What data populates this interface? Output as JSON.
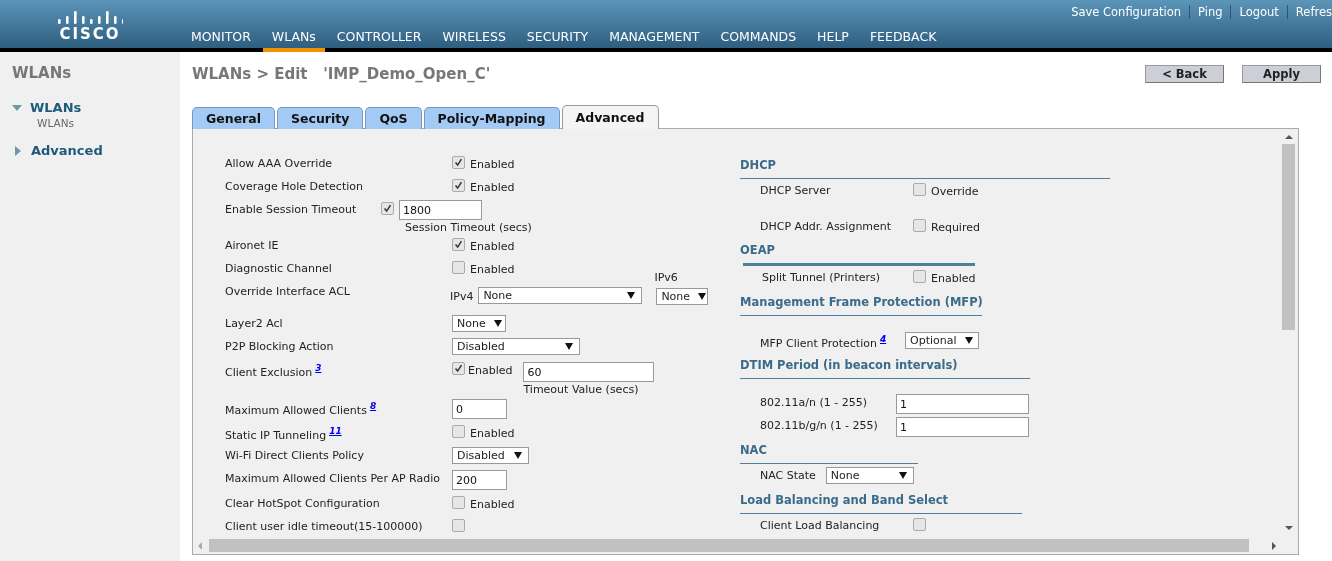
{
  "header": {
    "logo": "CISCO",
    "links": [
      {
        "label": "Save Configuration"
      },
      {
        "label": "Ping"
      },
      {
        "label": "Logout"
      },
      {
        "label": "Refres"
      }
    ],
    "nav": [
      {
        "label": "MONITOR",
        "selected": false
      },
      {
        "label": "WLANs",
        "selected": true
      },
      {
        "label": "CONTROLLER",
        "selected": false
      },
      {
        "label": "WIRELESS",
        "selected": false
      },
      {
        "label": "SECURITY",
        "selected": false
      },
      {
        "label": "MANAGEMENT",
        "selected": false
      },
      {
        "label": "COMMANDS",
        "selected": false
      },
      {
        "label": "HELP",
        "selected": false
      },
      {
        "label": "FEEDBACK",
        "selected": false
      }
    ]
  },
  "sidebar": {
    "title": "WLANs",
    "items": [
      {
        "label": "WLANs",
        "expanded": true,
        "children": [
          {
            "label": "WLANs"
          }
        ]
      },
      {
        "label": "Advanced",
        "expanded": false
      }
    ]
  },
  "page": {
    "title": "WLANs > Edit   'IMP_Demo_Open_C'",
    "buttons": [
      "< Back",
      "Apply"
    ]
  },
  "tabs": [
    {
      "label": "General",
      "selected": false
    },
    {
      "label": "Security",
      "selected": false
    },
    {
      "label": "QoS",
      "selected": false
    },
    {
      "label": "Policy-Mapping",
      "selected": false
    },
    {
      "label": "Advanced",
      "selected": true
    }
  ],
  "left_rows": [
    {
      "kind": "checkbox",
      "label": "Allow AAA Override",
      "checked": true,
      "option": "Enabled"
    },
    {
      "kind": "checkbox",
      "label": "Coverage Hole Detection",
      "checked": true,
      "option": "Enabled"
    },
    {
      "kind": "checkbox_field",
      "label": "Enable Session Timeout",
      "checked": true,
      "value": "1800",
      "caption": "Session Timeout (secs)"
    },
    {
      "kind": "checkbox",
      "label": "Aironet IE",
      "checked": true,
      "option": "Enabled"
    },
    {
      "kind": "checkbox",
      "label": "Diagnostic Channel",
      "checked": false,
      "option": "Enabled"
    },
    {
      "kind": "acl",
      "label": "Override Interface ACL",
      "ipv4_label": "IPv4",
      "ipv4_value": "None",
      "ipv6_label": "IPv6",
      "ipv6_value": "None"
    },
    {
      "kind": "dropdown",
      "label": "Layer2 Acl",
      "value": "None"
    },
    {
      "kind": "dropdown",
      "label": "P2P Blocking Action",
      "value": "Disabled"
    },
    {
      "kind": "checkbox_option_field",
      "label": "Client Exclusion",
      "footnote": "3",
      "checked": true,
      "option": "Enabled",
      "value": "60",
      "caption": "Timeout Value (secs)"
    },
    {
      "kind": "field",
      "label": "Maximum Allowed Clients",
      "footnote": "8",
      "value": "0"
    },
    {
      "kind": "checkbox",
      "label": "Static IP Tunneling",
      "footnote": "11",
      "checked": false,
      "option": "Enabled"
    },
    {
      "kind": "dropdown",
      "label": "Wi-Fi Direct Clients Policy",
      "value": "Disabled"
    },
    {
      "kind": "field",
      "label": "Maximum Allowed Clients Per AP Radio",
      "value": "200"
    },
    {
      "kind": "checkbox",
      "label": "Clear HotSpot Configuration",
      "checked": false,
      "option": "Enabled"
    },
    {
      "kind": "checkbox",
      "label": "Client user idle timeout(15-100000)",
      "checked": false
    }
  ],
  "right_sections": [
    {
      "heading": "DHCP",
      "rows": [
        {
          "kind": "checkbox",
          "label": "DHCP Server",
          "checked": false,
          "option": "Override"
        },
        {
          "kind": "checkbox",
          "label": "DHCP Addr. Assignment",
          "checked": false,
          "option": "Required"
        }
      ]
    },
    {
      "heading": "OEAP",
      "rows": [
        {
          "kind": "checkbox",
          "label": "Split Tunnel (Printers)",
          "checked": false,
          "option": "Enabled"
        }
      ]
    },
    {
      "heading": "Management Frame Protection (MFP)",
      "rows": [
        {
          "kind": "dropdown",
          "label": "MFP Client Protection",
          "footnote": "4",
          "value": "Optional"
        }
      ]
    },
    {
      "heading": "DTIM Period (in beacon intervals)",
      "rows": [
        {
          "kind": "field",
          "label": "802.11a/n (1 - 255)",
          "value": "1"
        },
        {
          "kind": "field",
          "label": "802.11b/g/n (1 - 255)",
          "value": "1"
        }
      ]
    },
    {
      "heading": "NAC",
      "rows": [
        {
          "kind": "dropdown",
          "label": "NAC State",
          "value": "None"
        }
      ]
    },
    {
      "heading": "Load Balancing and Band Select",
      "rows": [
        {
          "kind": "checkbox",
          "label": "Client Load Balancing",
          "checked": false
        }
      ]
    }
  ]
}
